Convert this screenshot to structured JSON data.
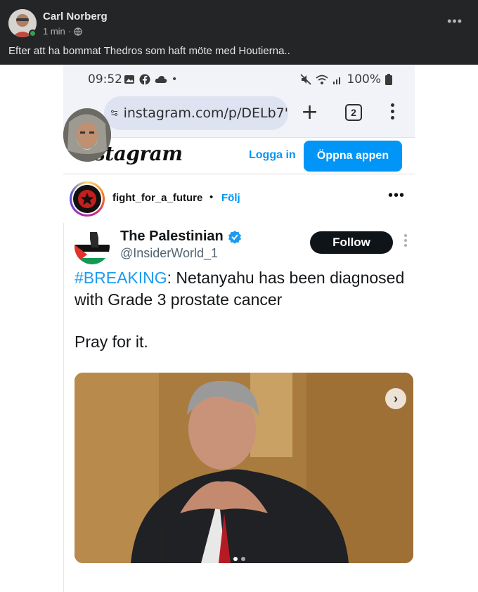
{
  "facebook": {
    "author": "Carl Norberg",
    "time": "1 min",
    "time_sep": "·",
    "more": "•••",
    "post_text": "Efter att ha bommat Thedros som haft möte med Houtierna.."
  },
  "phone": {
    "status": {
      "time": "09:52",
      "dot": "•",
      "battery": "100%"
    },
    "browser": {
      "url": "instagram.com/p/DELb7'",
      "tab_count": "2",
      "plus": "+"
    },
    "instagram": {
      "logo": "stagram",
      "login": "Logga in",
      "open_app": "Öppna appen"
    },
    "post": {
      "username": "fight_for_a_future",
      "separator": "•",
      "follow": "Följ",
      "more": "•••"
    },
    "tweet": {
      "name": "The Palestinian",
      "handle": "@InsiderWorld_1",
      "follow_button": "Follow",
      "hashtag": "#BREAKING",
      "body": ": Netanyahu has been diagnosed with Grade 3 prostate cancer",
      "body2": "Pray for it.",
      "next_arrow": "›"
    }
  },
  "colors": {
    "fb_bg": "#242526",
    "ig_blue": "#0095f6",
    "twitter_blue": "#1d9bf0"
  }
}
